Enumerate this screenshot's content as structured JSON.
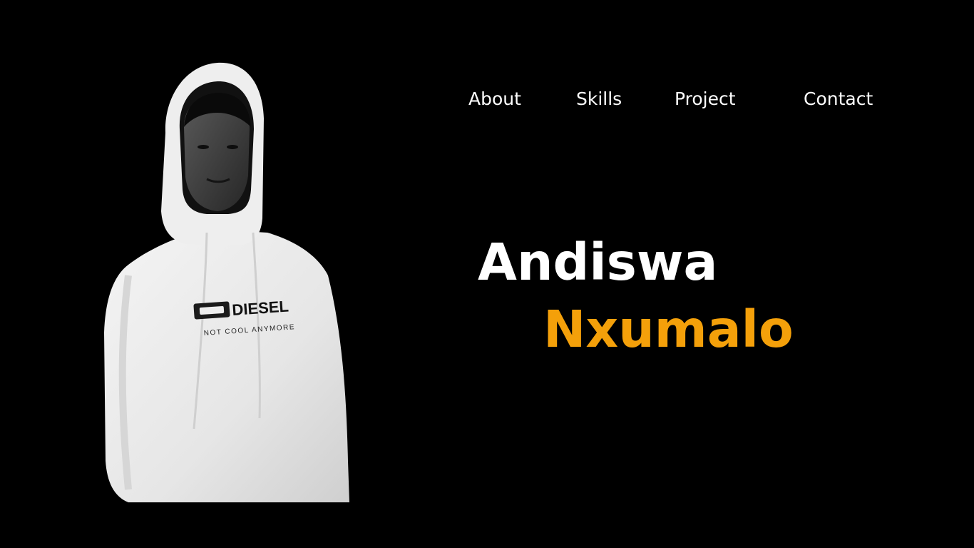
{
  "colors": {
    "background": "#000000",
    "text": "#ffffff",
    "accent": "#f4a00a"
  },
  "nav": {
    "items": [
      {
        "label": "About"
      },
      {
        "label": "Skills"
      },
      {
        "label": "Project"
      },
      {
        "label": "Contact"
      }
    ]
  },
  "hero": {
    "first_name": "Andiswa",
    "last_name": "Nxumalo"
  },
  "portrait": {
    "description_icon": "person-photo",
    "shirt_brand": "DIESEL",
    "shirt_tagline": "NOT COOL ANYMORE"
  }
}
